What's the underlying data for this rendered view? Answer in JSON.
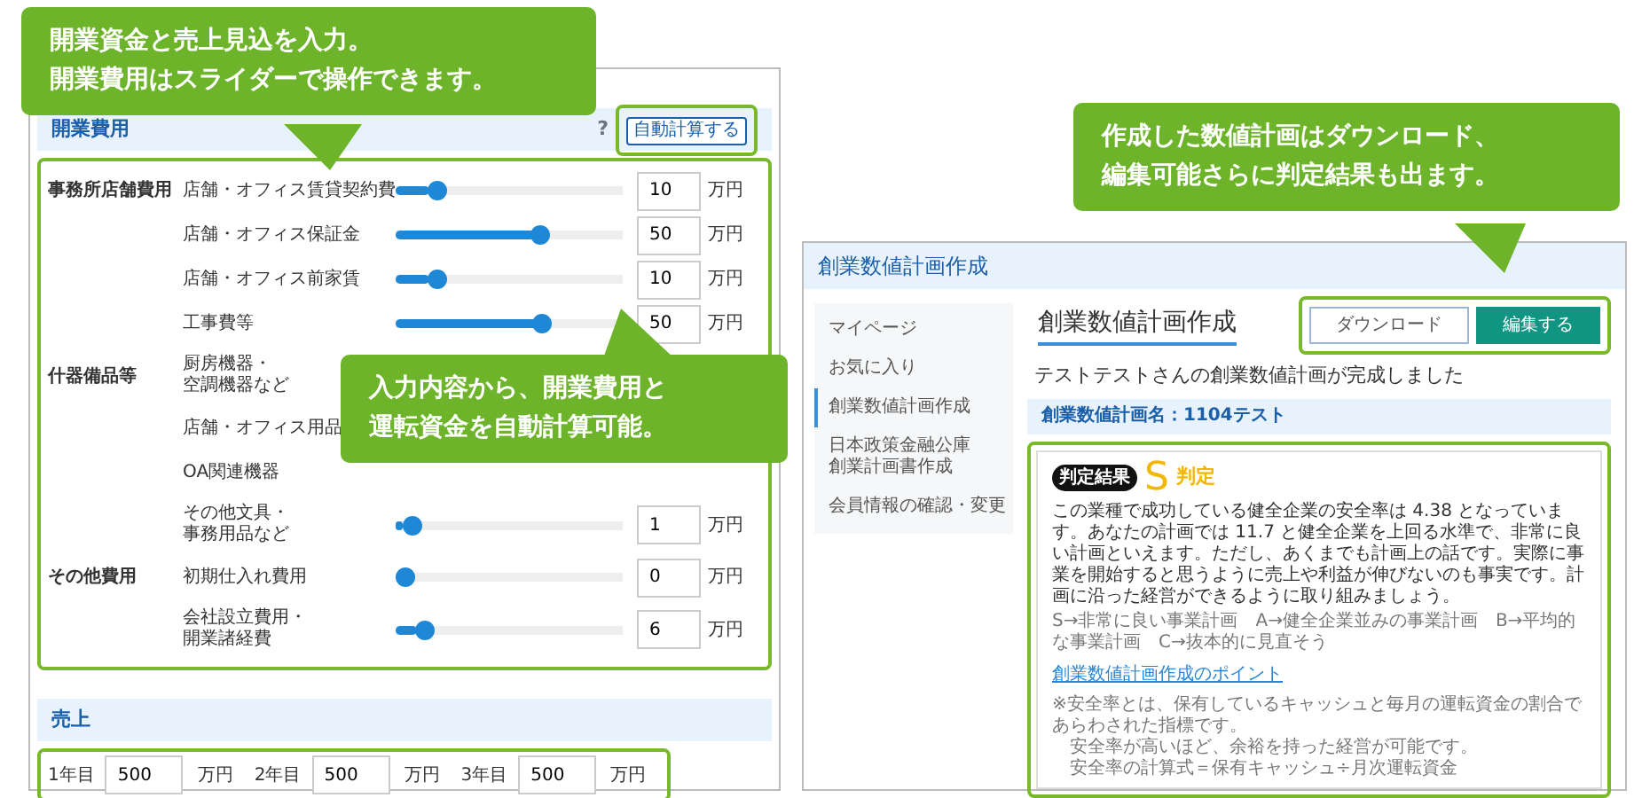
{
  "callouts": [
    {
      "lines": [
        "開業資金と売上見込を入力。",
        "開業費用はスライダーで操作できます。"
      ]
    },
    {
      "lines": [
        "入力内容から、開業費用と",
        "運転資金を自動計算可能。"
      ]
    },
    {
      "lines": [
        "作成した数値計画はダウンロード、",
        "編集可能さらに判定結果も出ます。"
      ]
    }
  ],
  "cost_panel": {
    "section_title": "開業費用",
    "help": "?",
    "auto_button": "自動計算する",
    "groups": [
      {
        "category": "事務所店舗費用",
        "items": [
          {
            "label": "店舗・オフィス賃貸契約費",
            "level": 0.15,
            "value": "10",
            "unit": "万円"
          },
          {
            "label": "店舗・オフィス保証金",
            "level": 0.65,
            "value": "50",
            "unit": "万円"
          },
          {
            "label": "店舗・オフィス前家賃",
            "level": 0.15,
            "value": "10",
            "unit": "万円"
          },
          {
            "label": "工事費等",
            "level": 0.66,
            "value": "50",
            "unit": "万円"
          }
        ]
      },
      {
        "category": "什器備品等",
        "items": [
          {
            "label": [
              "厨房機器・",
              "空調機器など"
            ]
          },
          {
            "label": "店舗・オフィス用品"
          },
          {
            "label": "OA関連機器"
          },
          {
            "label": [
              "その他文具・",
              "事務用品など"
            ],
            "level": 0.03,
            "value": "1",
            "unit": "万円"
          }
        ]
      },
      {
        "category": "その他費用",
        "items": [
          {
            "label": "初期仕入れ費用",
            "level": 0.0,
            "value": "0",
            "unit": "万円"
          },
          {
            "label": [
              "会社設立費用・",
              "開業諸経費"
            ],
            "level": 0.09,
            "value": "6",
            "unit": "万円"
          }
        ]
      }
    ]
  },
  "sales": {
    "title": "売上",
    "years": [
      {
        "label": "1年目",
        "value": "500",
        "unit": "万円"
      },
      {
        "label": "2年目",
        "value": "500",
        "unit": "万円"
      },
      {
        "label": "3年目",
        "value": "500",
        "unit": "万円"
      }
    ]
  },
  "plan_window": {
    "title": "創業数値計画作成",
    "sidebar": [
      {
        "label": "マイページ",
        "selected": false
      },
      {
        "label": "お気に入り",
        "selected": false
      },
      {
        "label": "創業数値計画作成",
        "selected": true
      },
      {
        "label": [
          "日本政策金融公庫",
          "創業計画書作成"
        ],
        "selected": false
      },
      {
        "label": "会員情報の確認・変更",
        "selected": false
      }
    ],
    "heading": "創業数値計画作成",
    "buttons": [
      {
        "label": "ダウンロード",
        "kind": "outline"
      },
      {
        "label": "編集する",
        "kind": "primary"
      }
    ],
    "message": "テストテストさんの創業数値計画が完成しました",
    "plan_name": "創業数値計画名：1104テスト",
    "result": {
      "badge": "判定結果",
      "grade": "S",
      "grade_label": "判定",
      "text": "この業種で成功している健全企業の安全率は 4.38 となっています。あなたの計画では 11.7 と健全企業を上回る水準で、非常に良い計画といえます。ただし、あくまでも計画上の話です。実際に事業を開始すると思うように売上や利益が伸びないのも事実です。計画に沿った経営ができるように取り組みましょう。",
      "scale": "S→非常に良い事業計画　A→健全企業並みの事業計画　B→平均的な事業計画　C→抜本的に見直そう",
      "link": "創業数値計画作成のポイント",
      "notes": [
        "※安全率とは、保有しているキャッシュと毎月の運転資金の割合であらわされた指標です。",
        "安全率が高いほど、余裕を持った経営が可能です。",
        "安全率の計算式＝保有キャッシュ÷月次運転資金"
      ]
    }
  }
}
